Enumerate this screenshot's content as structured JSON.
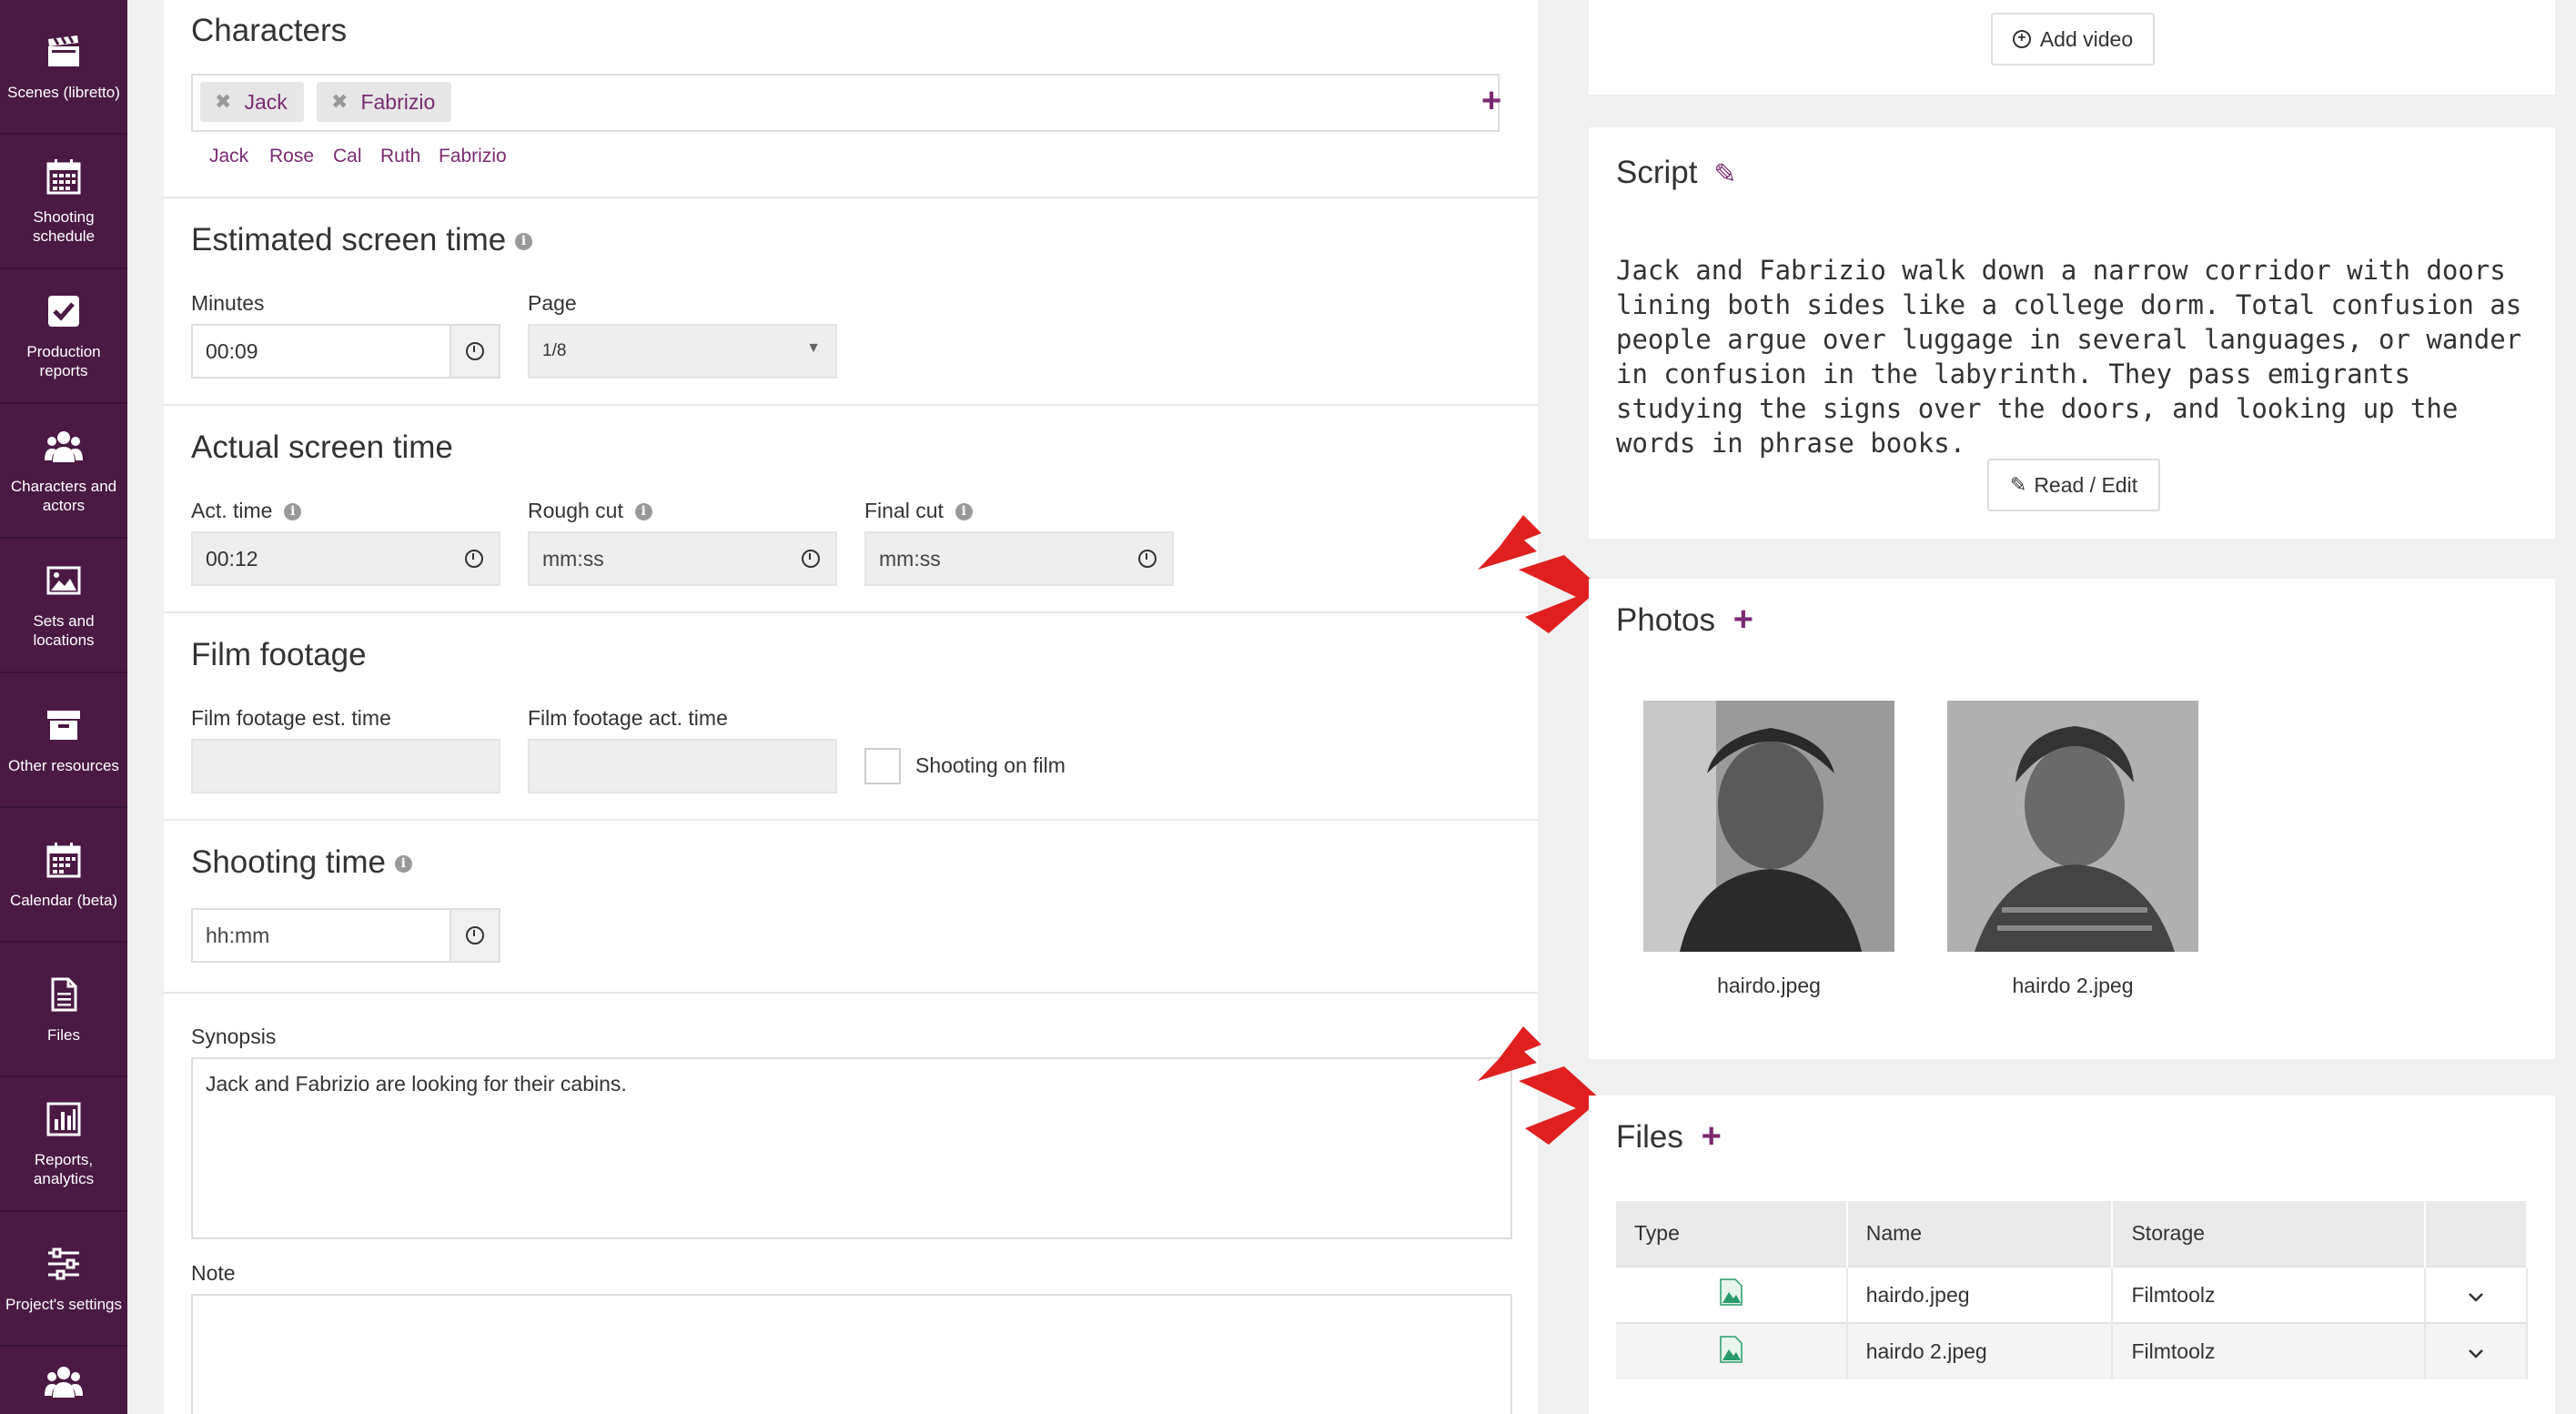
{
  "sidebar": {
    "items": [
      {
        "label": "Scenes (libretto)",
        "icon": "clapperboard-icon"
      },
      {
        "label": "Shooting schedule",
        "icon": "calendar-grid-icon"
      },
      {
        "label": "Production reports",
        "icon": "checkbox-icon"
      },
      {
        "label": "Characters and actors",
        "icon": "people-icon"
      },
      {
        "label": "Sets and locations",
        "icon": "image-icon"
      },
      {
        "label": "Other resources",
        "icon": "archive-icon"
      },
      {
        "label": "Calendar (beta)",
        "icon": "calendar-icon"
      },
      {
        "label": "Files",
        "icon": "file-icon"
      },
      {
        "label": "Reports, analytics",
        "icon": "bar-chart-icon"
      },
      {
        "label": "Project's settings",
        "icon": "sliders-icon"
      },
      {
        "label": "",
        "icon": "people-icon"
      }
    ]
  },
  "characters": {
    "title": "Characters",
    "tags": [
      "Jack",
      "Fabrizio"
    ],
    "suggestions": [
      "Jack",
      "Rose",
      "Cal",
      "Ruth",
      "Fabrizio"
    ]
  },
  "estimated": {
    "title": "Estimated screen time",
    "minutes_label": "Minutes",
    "minutes_value": "00:09",
    "page_label": "Page",
    "page_value": "1/8"
  },
  "actual": {
    "title": "Actual screen time",
    "act_label": "Act. time",
    "act_value": "00:12",
    "rough_label": "Rough cut",
    "rough_placeholder": "mm:ss",
    "final_label": "Final cut",
    "final_placeholder": "mm:ss"
  },
  "footage": {
    "title": "Film footage",
    "est_label": "Film footage est. time",
    "act_label": "Film footage act. time",
    "checkbox_label": "Shooting on film"
  },
  "shooting": {
    "title": "Shooting time",
    "placeholder": "hh:mm"
  },
  "synopsis": {
    "label": "Synopsis",
    "value": "Jack and Fabrizio are looking for their cabins."
  },
  "note": {
    "label": "Note"
  },
  "video": {
    "add_label": "Add video"
  },
  "script": {
    "title": "Script",
    "text": "Jack and Fabrizio walk down a narrow corridor with doors lining both sides like a college dorm. Total confusion as people argue over luggage in several languages, or wander in confusion in the labyrinth. They pass emigrants studying the signs over the doors, and looking up the words in phrase books.",
    "read_edit_label": "Read / Edit"
  },
  "photos": {
    "title": "Photos",
    "items": [
      {
        "caption": "hairdo.jpeg"
      },
      {
        "caption": "hairdo 2.jpeg"
      }
    ]
  },
  "files": {
    "title": "Files",
    "columns": [
      "Type",
      "Name",
      "Storage",
      ""
    ],
    "rows": [
      {
        "name": "hairdo.jpeg",
        "storage": "Filmtoolz"
      },
      {
        "name": "hairdo 2.jpeg",
        "storage": "Filmtoolz"
      }
    ]
  },
  "colors": {
    "sidebar": "#4a1a44",
    "accent": "#7a2a72",
    "arrow": "#e02020"
  }
}
